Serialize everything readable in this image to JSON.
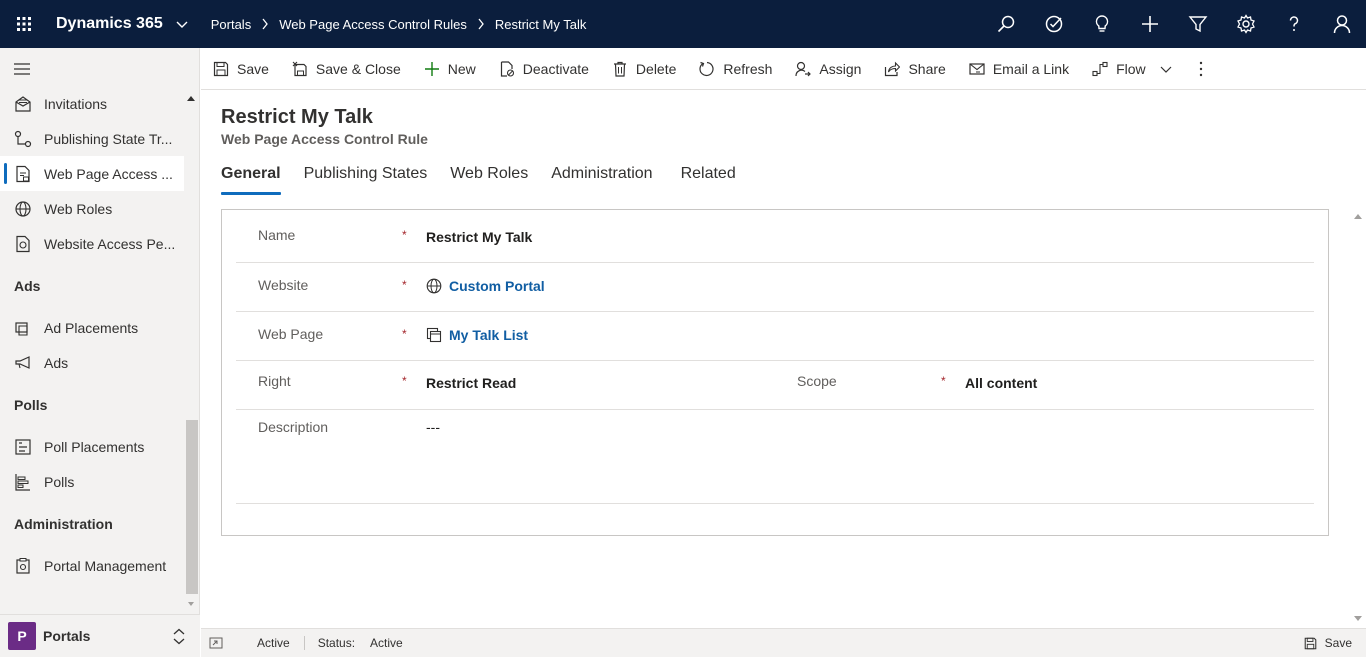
{
  "topbar": {
    "app_name": "Dynamics 365",
    "breadcrumbs": [
      "Portals",
      "Web Page Access Control Rules",
      "Restrict My Talk"
    ],
    "icons": [
      "search-icon",
      "task-icon",
      "lightbulb-icon",
      "plus-icon",
      "filter-icon",
      "settings-icon",
      "help-icon",
      "user-icon"
    ]
  },
  "sidebar": {
    "items_top": [
      {
        "label": "Invitations",
        "icon": "invitation-icon"
      },
      {
        "label": "Publishing State Tr...",
        "icon": "transition-icon"
      },
      {
        "label": "Web Page Access ...",
        "icon": "document-lock-icon",
        "active": true
      },
      {
        "label": "Web Roles",
        "icon": "globe-icon"
      },
      {
        "label": "Website Access Pe...",
        "icon": "permission-icon"
      }
    ],
    "group_ads": "Ads",
    "items_ads": [
      {
        "label": "Ad Placements",
        "icon": "placement-icon"
      },
      {
        "label": "Ads",
        "icon": "megaphone-icon"
      }
    ],
    "group_polls": "Polls",
    "items_polls": [
      {
        "label": "Poll Placements",
        "icon": "poll-placement-icon"
      },
      {
        "label": "Polls",
        "icon": "poll-icon"
      }
    ],
    "group_admin": "Administration",
    "items_admin": [
      {
        "label": "Portal Management",
        "icon": "portal-management-icon"
      }
    ],
    "area": {
      "badge": "P",
      "label": "Portals"
    }
  },
  "commands": [
    {
      "label": "Save",
      "icon": "save-icon"
    },
    {
      "label": "Save & Close",
      "icon": "save-close-icon"
    },
    {
      "label": "New",
      "icon": "plus-icon"
    },
    {
      "label": "Deactivate",
      "icon": "deactivate-icon"
    },
    {
      "label": "Delete",
      "icon": "trash-icon"
    },
    {
      "label": "Refresh",
      "icon": "refresh-icon"
    },
    {
      "label": "Assign",
      "icon": "assign-icon"
    },
    {
      "label": "Share",
      "icon": "share-icon"
    },
    {
      "label": "Email a Link",
      "icon": "email-icon"
    },
    {
      "label": "Flow",
      "icon": "flow-icon"
    }
  ],
  "record": {
    "title": "Restrict My Talk",
    "entity": "Web Page Access Control Rule"
  },
  "tabs": [
    "General",
    "Publishing States",
    "Web Roles",
    "Administration",
    "Related"
  ],
  "form": {
    "name_label": "Name",
    "name_value": "Restrict My Talk",
    "website_label": "Website",
    "website_value": "Custom Portal",
    "webpage_label": "Web Page",
    "webpage_value": "My Talk List",
    "right_label": "Right",
    "right_value": "Restrict Read",
    "scope_label": "Scope",
    "scope_value": "All content",
    "description_label": "Description",
    "description_value": "---",
    "required_marker": "*"
  },
  "status": {
    "state": "Active",
    "status_label": "Status:",
    "status_value": "Active",
    "save_label": "Save"
  },
  "colors": {
    "topbar": "#0b1e3d",
    "accent": "#0f6cbd",
    "link": "#115ea3",
    "required": "#a4262c",
    "area_badge": "#6b2c86"
  }
}
